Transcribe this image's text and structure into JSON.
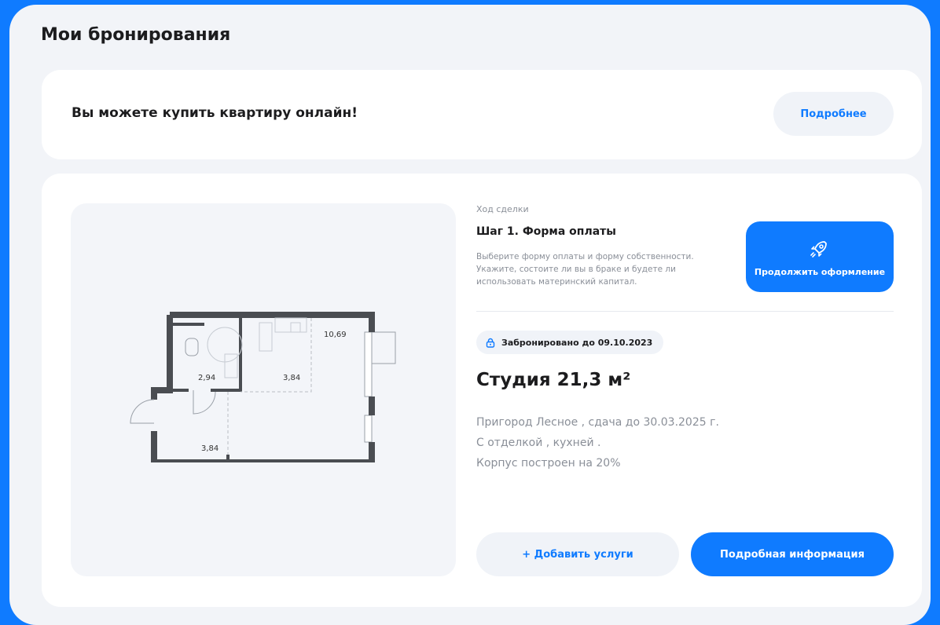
{
  "page": {
    "title": "Мои бронирования"
  },
  "banner": {
    "text": "Вы можете купить квартиру онлайн!",
    "button_label": "Подробнее"
  },
  "booking": {
    "progress_caption": "Ход сделки",
    "step_title": "Шаг 1. Форма оплаты",
    "step_description": "Выберите форму оплаты и форму собственности. Укажите, состоите ли вы в браке и будете ли использовать материнский капитал.",
    "continue_button_label": "Продолжить оформление",
    "continue_button_icon": "rocket-icon",
    "badge_icon": "lock-icon",
    "badge_text": "Забронировано до 09.10.2023",
    "apartment_title": "Студия 21,3 м²",
    "info_lines": [
      "Пригород Лесное , сдача до 30.03.2025 г.",
      "С отделкой , кухней .",
      "Корпус построен на 20%"
    ],
    "add_services_label": "+ Добавить услуги",
    "details_label": "Подробная информация"
  },
  "floor_plan": {
    "room_areas": [
      "10,69",
      "2,94",
      "3,84",
      "3,84"
    ]
  },
  "colors": {
    "accent": "#0f7bff",
    "background": "#f2f4f8",
    "card": "#ffffff",
    "muted_text": "#8a8f98",
    "wall": "#4a4d52"
  }
}
